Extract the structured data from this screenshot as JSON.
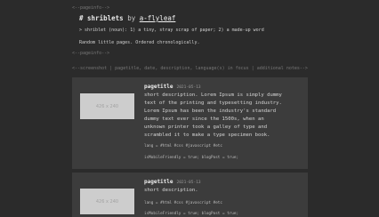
{
  "header": {
    "comment_open": "<--pageinfo-->",
    "comment_close": "<--pageinfo-->",
    "hash": "#",
    "site_name": "shriblets",
    "by_text": "by",
    "author": "a-flyleaf",
    "tagline": "> shriblet (noun): 1) a tiny, stray scrap of paper; 2) a made-up word",
    "description": "Random little pages. Ordered chronologically."
  },
  "legend_comment": "<--screenshot | pagetitle, date, description, language(s) in focus | additional notes-->",
  "cards": [
    {
      "thumb_label": "426 x 240",
      "title": "pagetitle",
      "date": "2021-05-13",
      "description_lines": [
        "short description. Lorem Ipsum is simply dummy",
        "text of the printing and typesetting industry.",
        "Lorem Ipsum has been the industry's standard",
        "dummy text ever since the 1500s, when an",
        "unknown printer took a galley of type and",
        "scrambled it to make a type specimen book."
      ],
      "lang": "lang = #html #css #javascript #etc",
      "flags": "isMobileFriendly = true; blogPost = true;"
    },
    {
      "thumb_label": "426 x 240",
      "title": "pagetitle",
      "date": "2021-05-13",
      "description_lines": [
        "short description."
      ],
      "lang": "lang = #html #css #javascript #etc",
      "flags": "isMobileFriendly = true; blogPost = true;"
    }
  ]
}
